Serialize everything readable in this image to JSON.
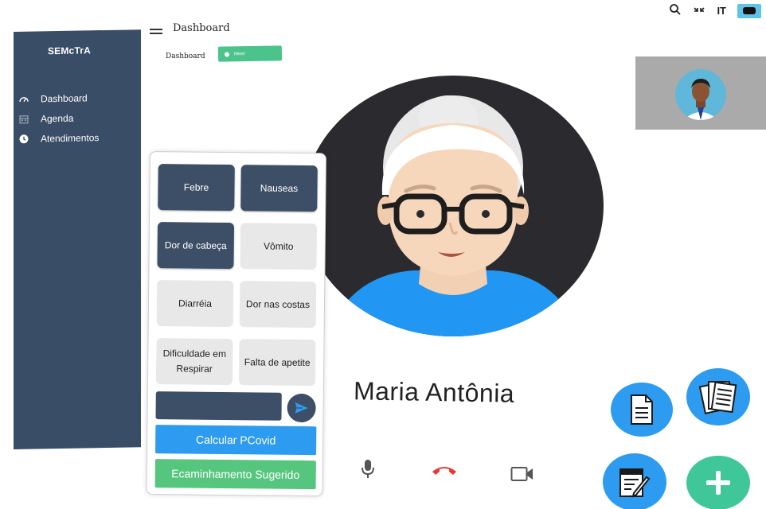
{
  "app": {
    "brand": "SEMcTrA"
  },
  "sidebar": {
    "items": [
      {
        "label": "Dashboard",
        "icon": "gauge-icon"
      },
      {
        "label": "Agenda",
        "icon": "calendar-icon"
      },
      {
        "label": "Atendimentos",
        "icon": "clock-icon"
      }
    ]
  },
  "header": {
    "title": "Dashboard",
    "breadcrumb": "Dashboard",
    "meet_label": "Meet"
  },
  "top_tools": [
    "search-icon",
    "expand-icon",
    "it-label",
    "toggle-icon"
  ],
  "top_tools_text": {
    "it": "IT"
  },
  "call": {
    "patient_name": "Maria Antônia",
    "controls": [
      "microphone-icon",
      "hang-up-icon",
      "camera-icon"
    ]
  },
  "symptoms": {
    "items": [
      {
        "label": "Febre",
        "selected": true
      },
      {
        "label": "Nauseas",
        "selected": true
      },
      {
        "label": "Dor de cabeça",
        "selected": true
      },
      {
        "label": "Vômito",
        "selected": false
      },
      {
        "label": "Diarréia",
        "selected": false
      },
      {
        "label": "Dor nas costas",
        "selected": false
      },
      {
        "label": "Dificuldade em Respirar",
        "selected": false
      },
      {
        "label": "Falta de apetite",
        "selected": false
      }
    ],
    "input_value": "",
    "calc_label": "Calcular PCovid",
    "referral_label": "Ecaminhamento Sugerido"
  },
  "fabs": [
    "document-icon",
    "documents-stack-icon",
    "edit-document-icon",
    "add-icon"
  ],
  "colors": {
    "sidebar": "#3a4d66",
    "dark_button": "#3d4f66",
    "primary_blue": "#2d9bf0",
    "green": "#56c67e",
    "fab_green": "#3fc79a",
    "meet_green": "#4cc38a",
    "hangup_red": "#e53935"
  }
}
